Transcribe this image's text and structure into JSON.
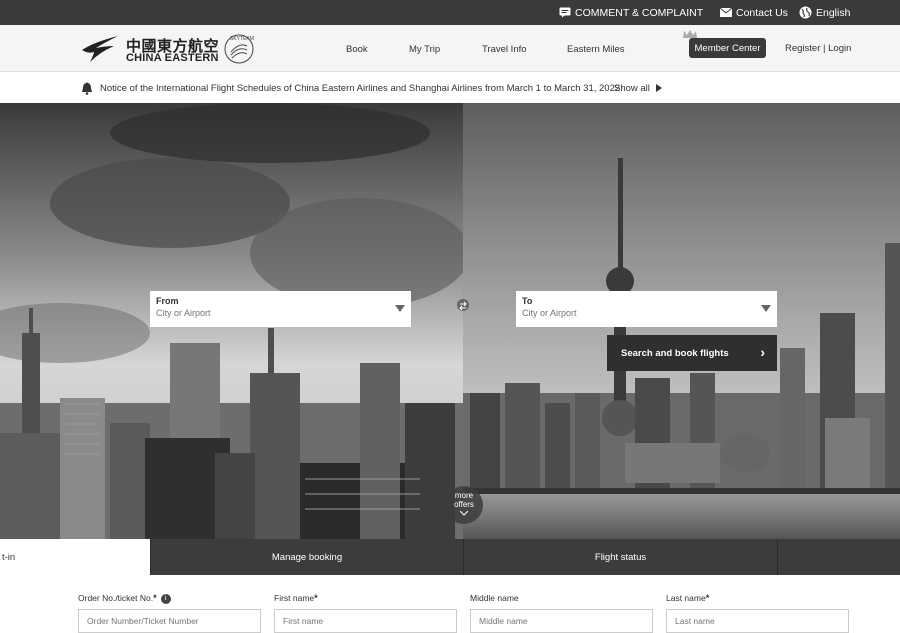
{
  "topbar": {
    "comment": "COMMENT & COMPLAINT",
    "contact": "Contact Us",
    "language": "English"
  },
  "brand": {
    "name_cn": "中國東方航空",
    "name_en": "CHINA EASTERN",
    "alliance": "SKYTEAM"
  },
  "nav": {
    "items": [
      "Book",
      "My Trip",
      "Travel Info",
      "Eastern Miles"
    ],
    "member_center": "Member Center",
    "register_login": "Register | Login"
  },
  "notice": {
    "text": "Notice of the International Flight Schedules of China Eastern Airlines and Shanghai Airlines from March 1 to March 31, 2022",
    "show_all": "Show all"
  },
  "search": {
    "from_label": "From",
    "to_label": "To",
    "placeholder": "City or Airport",
    "button": "Search and book flights"
  },
  "more_offers": {
    "line1": "more",
    "line2": "offers"
  },
  "tabs": [
    "t-in",
    "Manage booking",
    "Flight status"
  ],
  "form": {
    "order_label": "Order No./ticket No.",
    "order_placeholder": "Order Number/Ticket Number",
    "first_label": "First name",
    "first_placeholder": "First name",
    "middle_label": "Middle name",
    "middle_placeholder": "Middle name",
    "last_label": "Last name",
    "last_placeholder": "Last name"
  }
}
